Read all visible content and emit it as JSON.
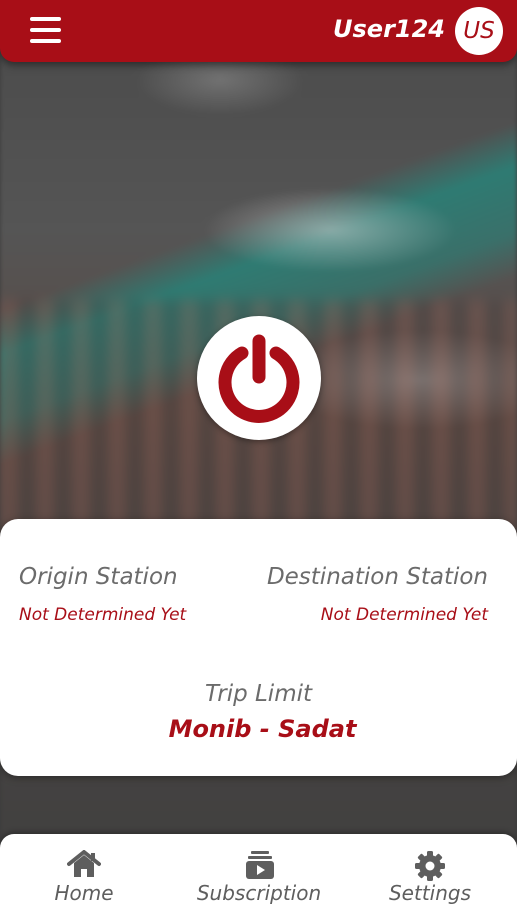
{
  "header": {
    "username": "User124",
    "avatar_initials": "US",
    "brand_color": "#a80e17"
  },
  "trip_card": {
    "origin_label": "Origin Station",
    "origin_value": "Not Determined Yet",
    "destination_label": "Destination Station",
    "destination_value": "Not Determined Yet",
    "trip_limit_label": "Trip Limit",
    "trip_limit_value": "Monib - Sadat"
  },
  "bottom_nav": {
    "items": [
      {
        "label": "Home",
        "icon": "home-icon"
      },
      {
        "label": "Subscription",
        "icon": "subscription-icon"
      },
      {
        "label": "Settings",
        "icon": "gear-icon"
      }
    ]
  }
}
